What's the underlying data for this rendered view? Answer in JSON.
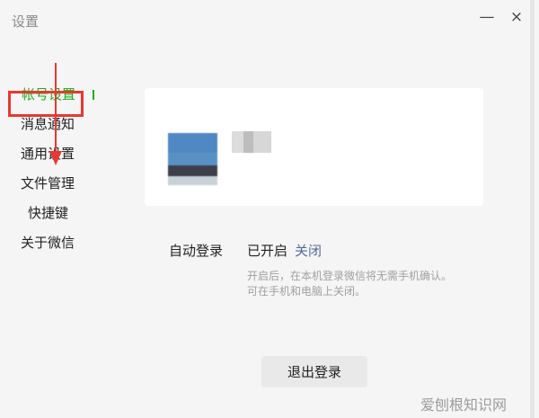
{
  "window": {
    "title": "设置",
    "minimize_symbol": "—",
    "close_symbol": "×"
  },
  "sidebar": {
    "items": [
      {
        "label": "帐号设置",
        "active": true
      },
      {
        "label": "消息通知"
      },
      {
        "label": "通用设置"
      },
      {
        "label": "文件管理",
        "highlighted": true
      },
      {
        "label": "快捷键"
      },
      {
        "label": "关于微信"
      }
    ],
    "active_color": "#1aad19"
  },
  "account": {
    "auto_login_label": "自动登录",
    "auto_login_status": "已开启",
    "auto_login_action": "关闭",
    "auto_login_hint_line1": "开启后，在本机登录微信将无需手机确认。",
    "auto_login_hint_line2": "可在手机和电脑上关闭。",
    "logout_label": "退出登录"
  },
  "watermark": "爱刨根知识网"
}
